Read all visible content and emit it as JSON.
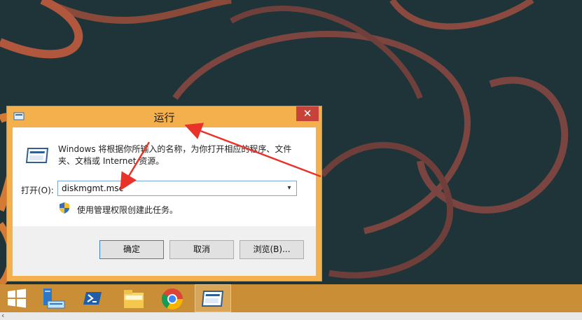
{
  "dialog": {
    "title": "运行",
    "close_label": "✕",
    "description": "Windows 将根据你所输入的名称，为你打开相应的程序、文件夹、文档或 Internet 资源。",
    "open_label": "打开(O):",
    "command_value": "diskmgmt.msc",
    "admin_note": "使用管理权限创建此任务。",
    "ok_label": "确定",
    "cancel_label": "取消",
    "browse_label": "浏览(B)..."
  },
  "taskbar": {
    "items": [
      {
        "name": "start",
        "icon": "windows-logo-icon"
      },
      {
        "name": "server-manager",
        "icon": "server-manager-icon"
      },
      {
        "name": "powershell",
        "icon": "powershell-icon"
      },
      {
        "name": "file-explorer",
        "icon": "folder-icon"
      },
      {
        "name": "chrome",
        "icon": "chrome-icon"
      },
      {
        "name": "run",
        "icon": "run-icon",
        "active": true
      }
    ]
  },
  "colors": {
    "desktop_bg": "#1f3438",
    "accent_orange": "#f5b04e",
    "close_red": "#c7433a",
    "annotation_red": "#e8322a"
  }
}
